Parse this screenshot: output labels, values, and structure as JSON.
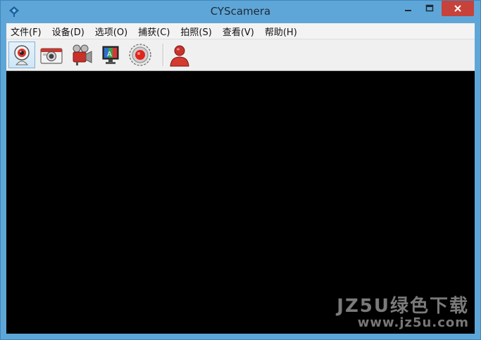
{
  "window": {
    "title": "CYScamera"
  },
  "menu": [
    {
      "label": "文件(F)"
    },
    {
      "label": "设备(D)"
    },
    {
      "label": "选项(O)"
    },
    {
      "label": "捕获(C)"
    },
    {
      "label": "拍照(S)"
    },
    {
      "label": "查看(V)"
    },
    {
      "label": "帮助(H)"
    }
  ],
  "toolbar": {
    "tools": [
      {
        "icon": "webcam-icon",
        "active": true
      },
      {
        "icon": "camera-icon"
      },
      {
        "icon": "video-camera-icon"
      },
      {
        "icon": "display-settings-icon"
      },
      {
        "icon": "record-icon"
      },
      {
        "icon": "user-icon"
      }
    ]
  },
  "watermark": {
    "line1": "JZ5U绿色下载",
    "line2": "www.jz5u.com"
  },
  "colors": {
    "titlebar": "#5fa6d8",
    "close_button": "#c7423a",
    "viewport": "#000000"
  }
}
